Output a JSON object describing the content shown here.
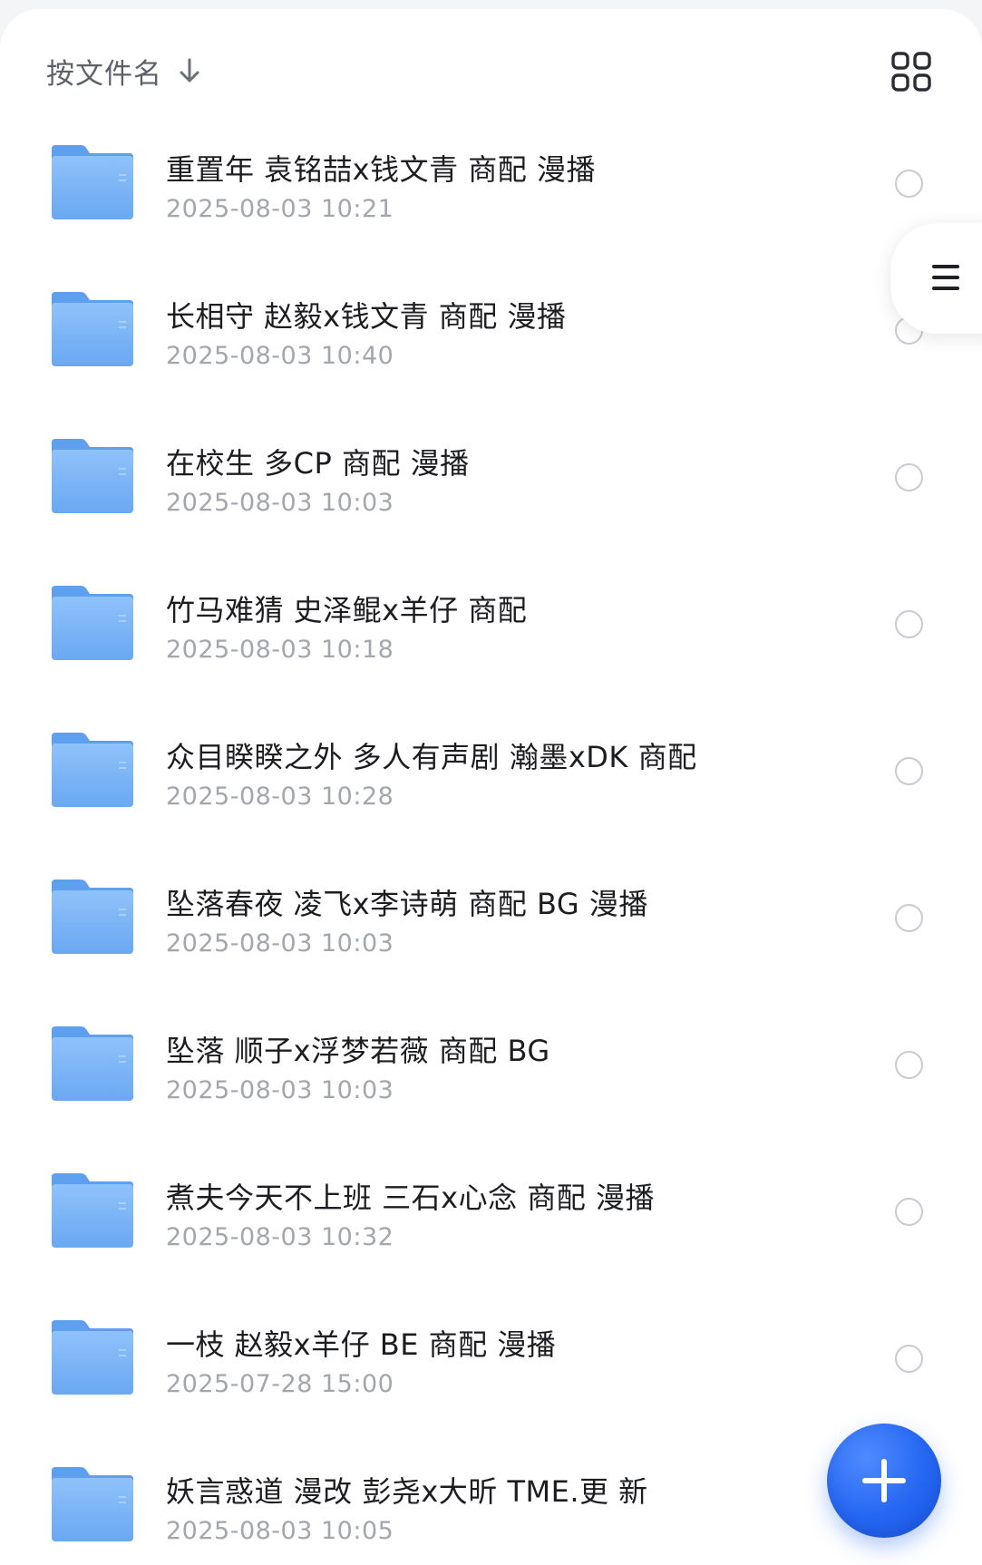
{
  "sort": {
    "label": "按文件名",
    "direction_icon": "arrow-down-icon"
  },
  "toolbar": {
    "view_toggle_icon": "grid-view-icon",
    "side_menu_icon": "menu-icon",
    "add_icon": "plus-icon"
  },
  "colors": {
    "accent": "#2566f2",
    "folder": "#7fb6f6",
    "title_text": "#1c1d21",
    "subtitle_text": "#a3a6ad"
  },
  "files": [
    {
      "name": "重置年 袁铭喆x钱文青 商配 漫播",
      "date": "2025-08-03 10:21"
    },
    {
      "name": "长相守 赵毅x钱文青 商配 漫播",
      "date": "2025-08-03 10:40"
    },
    {
      "name": "在校生 多CP 商配 漫播",
      "date": "2025-08-03 10:03"
    },
    {
      "name": "竹马难猜 史泽鲲x羊仔 商配",
      "date": "2025-08-03 10:18"
    },
    {
      "name": "众目睽睽之外 多人有声剧 瀚墨xDK 商配",
      "date": "2025-08-03 10:28"
    },
    {
      "name": "坠落春夜 凌飞x李诗萌 商配 BG 漫播",
      "date": "2025-08-03 10:03"
    },
    {
      "name": "坠落 顺子x浮梦若薇 商配 BG",
      "date": "2025-08-03 10:03"
    },
    {
      "name": "煮夫今天不上班 三石x心念 商配 漫播",
      "date": "2025-08-03 10:32"
    },
    {
      "name": "一枝 赵毅x羊仔 BE 商配 漫播",
      "date": "2025-07-28 15:00"
    },
    {
      "name": "妖言惑道 漫改 彭尧x大昕 TME.更 新",
      "date": "2025-08-03 10:05"
    }
  ]
}
